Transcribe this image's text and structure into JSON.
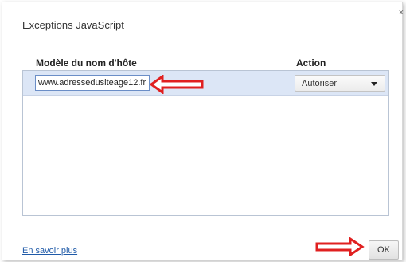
{
  "dialog": {
    "title": "Exceptions JavaScript",
    "close_label": "×"
  },
  "table": {
    "host_header": "Modèle du nom d'hôte",
    "action_header": "Action",
    "rows": [
      {
        "host": "www.adressedusiteage12.fr",
        "action": "Autoriser"
      }
    ],
    "action_options": [
      "Autoriser"
    ]
  },
  "footer": {
    "learn_more": "En savoir plus",
    "ok_label": "OK"
  },
  "annotations": {
    "arrow_color": "#e02020",
    "selected_row_color": "#dce6f6"
  }
}
